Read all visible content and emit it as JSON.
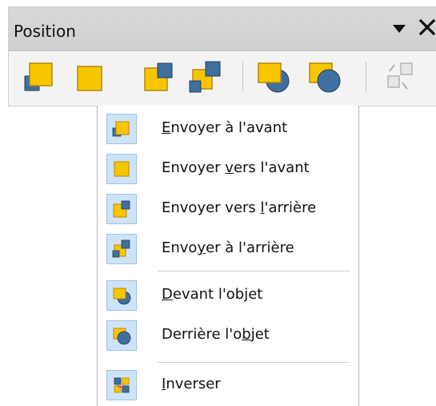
{
  "panel": {
    "title": "Position",
    "menu_icon": "triangle-down-icon",
    "close_icon": "close-icon",
    "toolbar": [
      {
        "name": "bring-to-front",
        "icon": "bring-to-front-icon"
      },
      {
        "name": "bring-forward",
        "icon": "bring-forward-icon"
      },
      {
        "name": "send-backward",
        "icon": "send-backward-icon"
      },
      {
        "name": "send-to-back",
        "icon": "send-to-back-icon"
      },
      {
        "name": "in-front-of-object",
        "icon": "in-front-of-object-icon"
      },
      {
        "name": "behind-object",
        "icon": "behind-object-icon"
      },
      {
        "name": "reverse",
        "icon": "reverse-icon",
        "disabled": true
      }
    ]
  },
  "menu": {
    "items": [
      {
        "pre": "",
        "u": "E",
        "post": "nvoyer à l'avant",
        "icon": "bring-to-front-icon"
      },
      {
        "pre": "Envoyer ",
        "u": "v",
        "post": "ers l'avant",
        "icon": "bring-forward-icon"
      },
      {
        "pre": "Envoyer vers ",
        "u": "l",
        "post": "'arrière",
        "icon": "send-backward-icon"
      },
      {
        "pre": "Envo",
        "u": "y",
        "post": "er à l'arrière",
        "icon": "send-to-back-icon"
      },
      {
        "pre": "",
        "u": "D",
        "post": "evant l'objet",
        "icon": "in-front-of-object-icon"
      },
      {
        "pre": "Derrière l'o",
        "u": "b",
        "post": "jet",
        "icon": "behind-object-icon"
      },
      {
        "pre": "",
        "u": "I",
        "post": "nverser",
        "icon": "reverse-icon"
      }
    ]
  },
  "colors": {
    "yellow": "#f7c600",
    "blue": "#3f6f9e",
    "icon_bg": "#cfe3f7"
  }
}
